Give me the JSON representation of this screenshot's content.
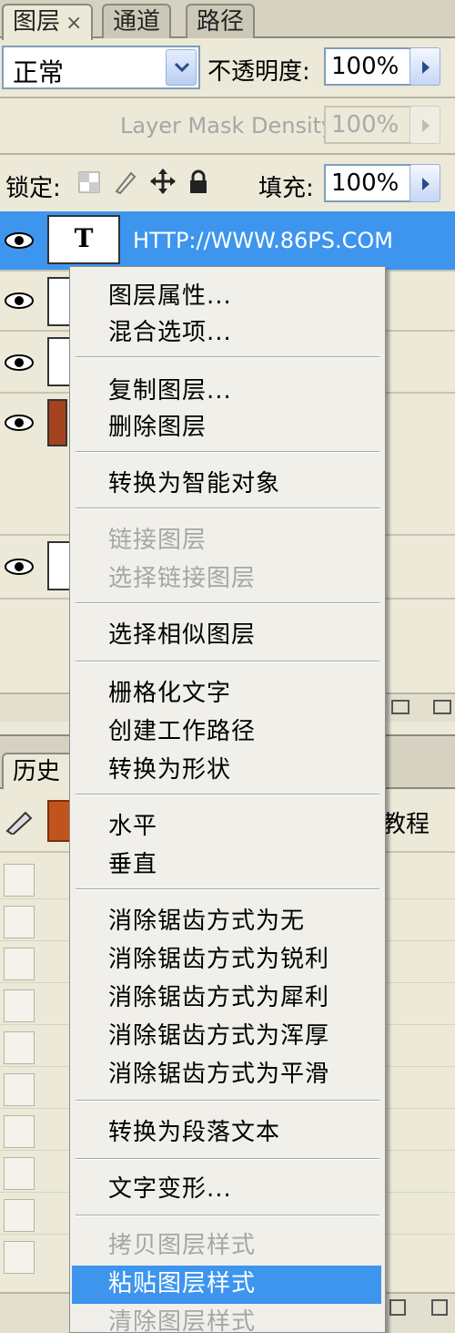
{
  "tabs": [
    {
      "label": "图层",
      "close": "×"
    },
    {
      "label": "通道"
    },
    {
      "label": "路径"
    }
  ],
  "blend": {
    "mode": "正常",
    "opacity_label": "不透明度:",
    "opacity_value": "100%"
  },
  "mask": {
    "label": "Layer Mask Density",
    "value": "100%"
  },
  "lock": {
    "label": "锁定:",
    "fill_label": "填充:",
    "fill_value": "100%"
  },
  "layers": {
    "selected_name": "HTTP://WWW.86PS.COM",
    "text_thumb": "T"
  },
  "history": {
    "tab": "历史",
    "label": "教程"
  },
  "menu": {
    "items": [
      {
        "label": "图层属性...",
        "state": "normal"
      },
      {
        "label": "混合选项...",
        "state": "normal"
      },
      {
        "label": "复制图层...",
        "state": "normal"
      },
      {
        "label": "删除图层",
        "state": "normal"
      },
      {
        "label": "转换为智能对象",
        "state": "normal"
      },
      {
        "label": "链接图层",
        "state": "disabled"
      },
      {
        "label": "选择链接图层",
        "state": "disabled"
      },
      {
        "label": "选择相似图层",
        "state": "normal"
      },
      {
        "label": "栅格化文字",
        "state": "normal"
      },
      {
        "label": "创建工作路径",
        "state": "normal"
      },
      {
        "label": "转换为形状",
        "state": "normal"
      },
      {
        "label": "水平",
        "state": "normal"
      },
      {
        "label": "垂直",
        "state": "normal"
      },
      {
        "label": "消除锯齿方式为无",
        "state": "normal"
      },
      {
        "label": "消除锯齿方式为锐利",
        "state": "normal"
      },
      {
        "label": "消除锯齿方式为犀利",
        "state": "normal"
      },
      {
        "label": "消除锯齿方式为浑厚",
        "state": "normal"
      },
      {
        "label": "消除锯齿方式为平滑",
        "state": "normal"
      },
      {
        "label": "转换为段落文本",
        "state": "normal"
      },
      {
        "label": "文字变形...",
        "state": "normal"
      },
      {
        "label": "拷贝图层样式",
        "state": "disabled"
      },
      {
        "label": "粘贴图层样式",
        "state": "highlighted"
      },
      {
        "label": "清除图层样式",
        "state": "disabled"
      }
    ]
  },
  "colors": {
    "highlight": "#3d95ee",
    "panel": "#ece9d8"
  }
}
